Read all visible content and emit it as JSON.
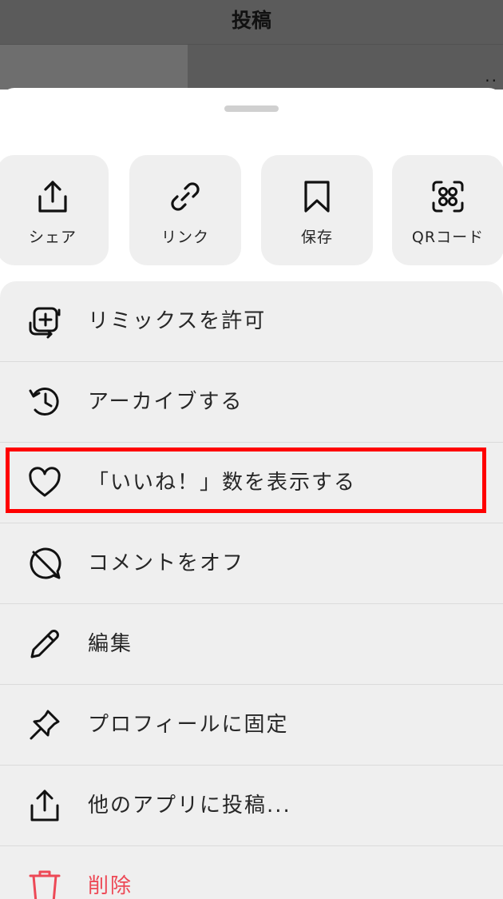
{
  "header": {
    "title": "投稿"
  },
  "actions": [
    {
      "id": "share",
      "label": "シェア",
      "icon": "share-icon"
    },
    {
      "id": "link",
      "label": "リンク",
      "icon": "link-icon"
    },
    {
      "id": "save",
      "label": "保存",
      "icon": "bookmark-icon"
    },
    {
      "id": "qr",
      "label": "QRコード",
      "icon": "qr-code-icon"
    }
  ],
  "menu": {
    "items": [
      {
        "id": "remix",
        "label": "リミックスを許可",
        "icon": "remix-icon"
      },
      {
        "id": "archive",
        "label": "アーカイブする",
        "icon": "archive-icon"
      },
      {
        "id": "likes",
        "label": "「いいね！」数を表示する",
        "icon": "heart-icon"
      },
      {
        "id": "comments",
        "label": "コメントをオフ",
        "icon": "comment-off-icon"
      },
      {
        "id": "edit",
        "label": "編集",
        "icon": "pencil-icon"
      },
      {
        "id": "pin",
        "label": "プロフィールに固定",
        "icon": "pin-icon"
      },
      {
        "id": "post-other",
        "label": "他のアプリに投稿...",
        "icon": "share-icon"
      },
      {
        "id": "delete",
        "label": "削除",
        "icon": "trash-icon"
      }
    ]
  },
  "colors": {
    "danger": "#ed4956",
    "highlight": "#ff0000",
    "menu_bg": "#efefef"
  }
}
